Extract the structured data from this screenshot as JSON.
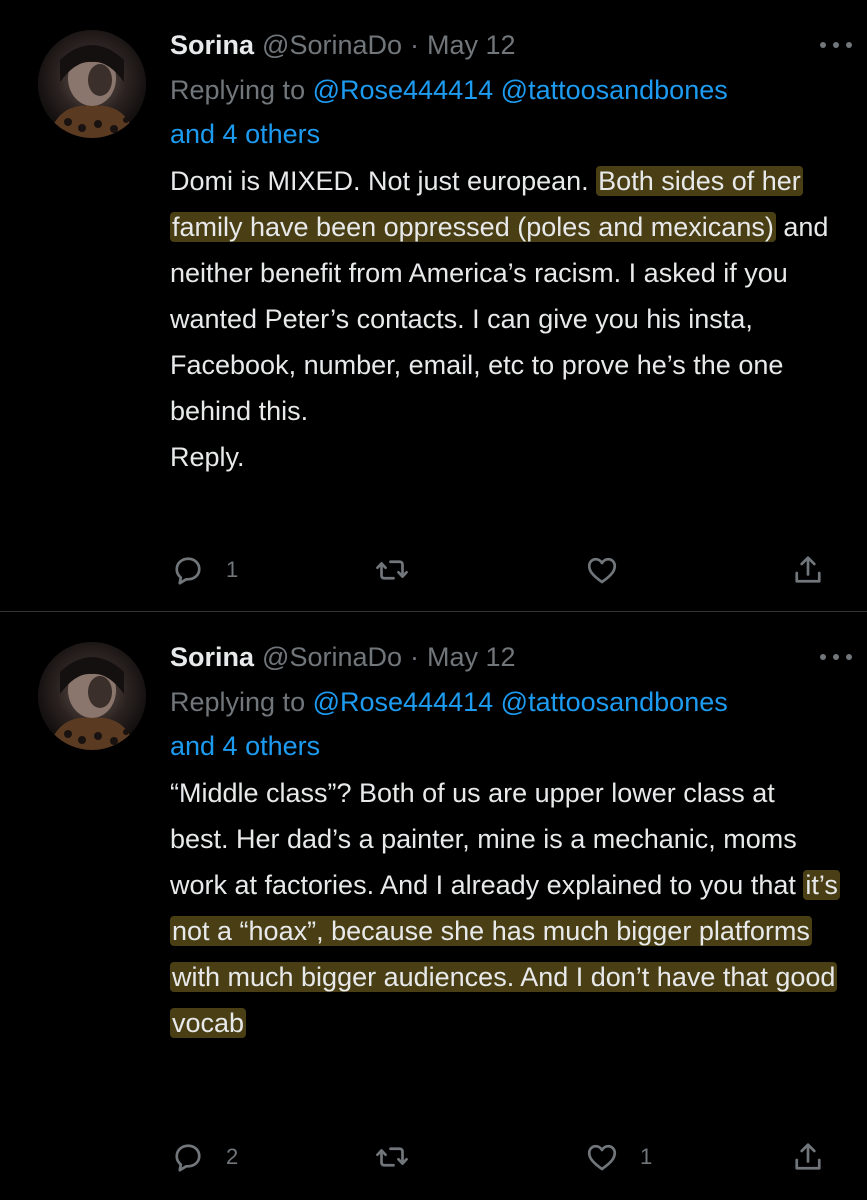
{
  "tweets": [
    {
      "name": "Sorina",
      "handle": "@SorinaDo",
      "dot": "·",
      "date": "May 12",
      "reply_prefix": "Replying to ",
      "mentions": [
        "@Rose444414",
        "@tattoosandbones"
      ],
      "others": "and 4 others",
      "body": {
        "p1": "Domi is MIXED. Not just european. ",
        "highlight": "Both sides of her family have been oppressed (poles and mexicans)",
        "p2": " and neither benefit from America’s racism. I asked if you wanted Peter’s contacts. I can give you his insta, Facebook, number, email, etc to prove he’s the one behind this.",
        "p3": "Reply."
      },
      "reply_count": "1",
      "retweet_count": "",
      "like_count": ""
    },
    {
      "name": "Sorina",
      "handle": "@SorinaDo",
      "dot": "·",
      "date": "May 12",
      "reply_prefix": "Replying to ",
      "mentions": [
        "@Rose444414",
        "@tattoosandbones"
      ],
      "others": "and 4 others",
      "body": {
        "p1": "“Middle class”? Both of us are upper lower class at best. Her dad’s a painter, mine is a mechanic, moms work at factories. And I already explained to you that ",
        "highlight": "it’s not a “hoax”, because she has much bigger platforms with much bigger audiences. And I don’t have that good vocab",
        "p2": ""
      },
      "reply_count": "2",
      "retweet_count": "",
      "like_count": "1"
    }
  ],
  "colors": {
    "background": "#000000",
    "text": "#e7e9ea",
    "muted": "#71767b",
    "link": "#1d9bf0",
    "highlight": "#4a3f14",
    "divider": "#2f3336"
  },
  "icons": {
    "more": "more-horizontal-icon",
    "reply": "reply-bubble-icon",
    "retweet": "retweet-icon",
    "like": "heart-icon",
    "share": "share-icon"
  }
}
